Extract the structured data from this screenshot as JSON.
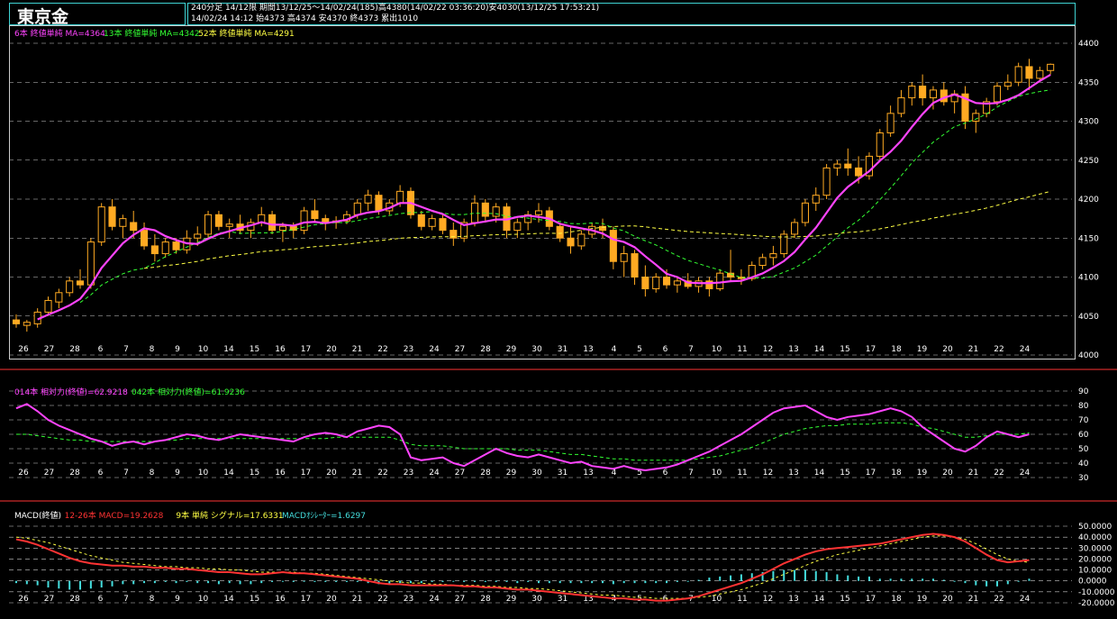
{
  "header": {
    "instrument": "東京金",
    "info_line1": "240分足 14/12限 期間13/12/25～14/02/24(185)高4380(14/02/22 03:36:20)安4030(13/12/25 17:53:21)",
    "info_line2": "14/02/24 14:12 始4373 高4374 安4370 終4373 累出1010"
  },
  "legends": {
    "main": [
      {
        "text": "6本 終値単純 MA=4364",
        "color": "#ff44ff"
      },
      {
        "text": "13本 終値単純 MA=4342",
        "color": "#33ff33"
      },
      {
        "text": "52本 終値単純 MA=4291",
        "color": "#ffff44"
      }
    ],
    "rsi": [
      {
        "text": "014本 相対力(終値)=62.9218",
        "color": "#ff44ff"
      },
      {
        "text": "042本 相対力(終値)=61.9236",
        "color": "#33ff33"
      }
    ],
    "macd": [
      {
        "text": "MACD(終値)",
        "color": "#ffffff"
      },
      {
        "text": "12-26本 MACD=19.2628",
        "color": "#ff3333"
      },
      {
        "text": "9本 単純 シグナル=17.6331",
        "color": "#ffff44"
      },
      {
        "text": "MACDｵｼﾚｰﾀｰ=1.6297",
        "color": "#44dddd"
      }
    ]
  },
  "day_labels": [
    "26",
    "27",
    "28",
    "6",
    "7",
    "8",
    "9",
    "10",
    "14",
    "15",
    "16",
    "17",
    "20",
    "21",
    "22",
    "23",
    "24",
    "27",
    "28",
    "29",
    "30",
    "31",
    "13",
    "4",
    "5",
    "6",
    "7",
    "10",
    "11",
    "12",
    "13",
    "14",
    "15",
    "17",
    "18",
    "19",
    "20",
    "21",
    "22",
    "24"
  ],
  "colors": {
    "up": "#ffaa22",
    "down": "#ffaa22",
    "ma6": "#ff44ff",
    "ma13": "#33ff33",
    "ma52": "#ffff44",
    "macd": "#ff3333",
    "signal": "#ffff44",
    "osc": "#44dddd",
    "frame": "#3fd3d3"
  },
  "chart_data": [
    {
      "type": "candlestick",
      "name": "price",
      "ylim": [
        4000,
        4400
      ],
      "yticks": [
        "4400",
        "4350",
        "4300",
        "4250",
        "4200",
        "4150",
        "4100",
        "4050",
        "4000"
      ],
      "ohlc": [
        [
          4045,
          4052,
          4035,
          4040
        ],
        [
          4038,
          4045,
          4030,
          4042
        ],
        [
          4040,
          4060,
          4035,
          4055
        ],
        [
          4055,
          4075,
          4050,
          4070
        ],
        [
          4068,
          4085,
          4060,
          4080
        ],
        [
          4080,
          4100,
          4075,
          4095
        ],
        [
          4095,
          4110,
          4085,
          4090
        ],
        [
          4090,
          4150,
          4085,
          4145
        ],
        [
          4145,
          4195,
          4140,
          4190
        ],
        [
          4190,
          4200,
          4160,
          4165
        ],
        [
          4165,
          4180,
          4150,
          4175
        ],
        [
          4170,
          4185,
          4150,
          4160
        ],
        [
          4160,
          4170,
          4135,
          4140
        ],
        [
          4140,
          4155,
          4120,
          4130
        ],
        [
          4130,
          4150,
          4125,
          4145
        ],
        [
          4145,
          4150,
          4130,
          4135
        ],
        [
          4135,
          4160,
          4130,
          4150
        ],
        [
          4150,
          4165,
          4140,
          4155
        ],
        [
          4155,
          4185,
          4150,
          4180
        ],
        [
          4180,
          4185,
          4160,
          4165
        ],
        [
          4165,
          4175,
          4150,
          4168
        ],
        [
          4168,
          4180,
          4155,
          4160
        ],
        [
          4160,
          4175,
          4150,
          4170
        ],
        [
          4170,
          4190,
          4165,
          4180
        ],
        [
          4180,
          4185,
          4155,
          4160
        ],
        [
          4160,
          4170,
          4145,
          4165
        ],
        [
          4165,
          4170,
          4150,
          4160
        ],
        [
          4160,
          4190,
          4155,
          4185
        ],
        [
          4185,
          4200,
          4170,
          4175
        ],
        [
          4175,
          4180,
          4160,
          4170
        ],
        [
          4170,
          4178,
          4162,
          4172
        ],
        [
          4172,
          4185,
          4168,
          4180
        ],
        [
          4180,
          4200,
          4175,
          4195
        ],
        [
          4195,
          4212,
          4185,
          4205
        ],
        [
          4205,
          4210,
          4180,
          4185
        ],
        [
          4185,
          4200,
          4180,
          4195
        ],
        [
          4195,
          4218,
          4190,
          4210
        ],
        [
          4210,
          4215,
          4175,
          4180
        ],
        [
          4180,
          4185,
          4160,
          4165
        ],
        [
          4165,
          4180,
          4160,
          4175
        ],
        [
          4175,
          4180,
          4155,
          4160
        ],
        [
          4160,
          4170,
          4140,
          4150
        ],
        [
          4150,
          4175,
          4145,
          4170
        ],
        [
          4170,
          4205,
          4165,
          4195
        ],
        [
          4195,
          4200,
          4170,
          4178
        ],
        [
          4178,
          4195,
          4170,
          4190
        ],
        [
          4190,
          4195,
          4150,
          4160
        ],
        [
          4160,
          4175,
          4150,
          4170
        ],
        [
          4170,
          4185,
          4160,
          4180
        ],
        [
          4180,
          4195,
          4170,
          4185
        ],
        [
          4185,
          4190,
          4160,
          4165
        ],
        [
          4165,
          4170,
          4145,
          4150
        ],
        [
          4150,
          4165,
          4130,
          4140
        ],
        [
          4140,
          4160,
          4135,
          4155
        ],
        [
          4155,
          4170,
          4150,
          4165
        ],
        [
          4165,
          4175,
          4150,
          4160
        ],
        [
          4160,
          4165,
          4110,
          4120
        ],
        [
          4120,
          4140,
          4100,
          4130
        ],
        [
          4130,
          4135,
          4090,
          4100
        ],
        [
          4100,
          4115,
          4075,
          4085
        ],
        [
          4085,
          4105,
          4080,
          4100
        ],
        [
          4100,
          4110,
          4085,
          4090
        ],
        [
          4090,
          4100,
          4080,
          4095
        ],
        [
          4095,
          4105,
          4085,
          4088
        ],
        [
          4088,
          4100,
          4080,
          4095
        ],
        [
          4095,
          4100,
          4075,
          4085
        ],
        [
          4085,
          4110,
          4082,
          4105
        ],
        [
          4105,
          4135,
          4095,
          4100
        ],
        [
          4100,
          4110,
          4090,
          4098
        ],
        [
          4098,
          4120,
          4095,
          4115
        ],
        [
          4115,
          4130,
          4110,
          4125
        ],
        [
          4125,
          4140,
          4115,
          4130
        ],
        [
          4130,
          4160,
          4125,
          4155
        ],
        [
          4155,
          4175,
          4150,
          4170
        ],
        [
          4170,
          4200,
          4165,
          4195
        ],
        [
          4195,
          4215,
          4185,
          4205
        ],
        [
          4205,
          4245,
          4200,
          4240
        ],
        [
          4240,
          4250,
          4230,
          4245
        ],
        [
          4245,
          4265,
          4230,
          4240
        ],
        [
          4240,
          4255,
          4220,
          4230
        ],
        [
          4230,
          4260,
          4225,
          4255
        ],
        [
          4255,
          4290,
          4250,
          4285
        ],
        [
          4285,
          4320,
          4280,
          4310
        ],
        [
          4310,
          4340,
          4305,
          4330
        ],
        [
          4330,
          4350,
          4320,
          4345
        ],
        [
          4345,
          4360,
          4320,
          4330
        ],
        [
          4330,
          4345,
          4315,
          4340
        ],
        [
          4340,
          4350,
          4320,
          4325
        ],
        [
          4325,
          4340,
          4310,
          4335
        ],
        [
          4335,
          4345,
          4290,
          4300
        ],
        [
          4300,
          4315,
          4285,
          4310
        ],
        [
          4310,
          4330,
          4305,
          4325
        ],
        [
          4325,
          4350,
          4320,
          4345
        ],
        [
          4345,
          4360,
          4340,
          4350
        ],
        [
          4350,
          4375,
          4345,
          4370
        ],
        [
          4370,
          4380,
          4340,
          4355
        ],
        [
          4355,
          4370,
          4350,
          4365
        ],
        [
          4365,
          4374,
          4360,
          4373
        ]
      ]
    },
    {
      "type": "line",
      "name": "rsi",
      "ylim": [
        30,
        90
      ],
      "yticks": [
        "90",
        "80",
        "70",
        "60",
        "50",
        "40",
        "30"
      ],
      "series": [
        {
          "name": "014本 相対力(終値)",
          "values": [
            78,
            81,
            76,
            70,
            66,
            63,
            60,
            57,
            55,
            52,
            54,
            55,
            53,
            55,
            56,
            58,
            60,
            59,
            57,
            56,
            58,
            60,
            59,
            58,
            57,
            56,
            55,
            58,
            60,
            61,
            60,
            58,
            62,
            64,
            66,
            65,
            60,
            44,
            42,
            43,
            44,
            40,
            38,
            42,
            46,
            50,
            47,
            45,
            44,
            46,
            44,
            42,
            40,
            41,
            38,
            37,
            36,
            38,
            36,
            35,
            36,
            37,
            39,
            42,
            45,
            48,
            52,
            56,
            60,
            65,
            70,
            75,
            78,
            79,
            80,
            76,
            72,
            70,
            72,
            73,
            74,
            76,
            78,
            76,
            72,
            65,
            60,
            55,
            50,
            48,
            52,
            58,
            62,
            60,
            58,
            60
          ]
        },
        {
          "name": "042本 相対力(終値)",
          "values": [
            60,
            60,
            59,
            58,
            57,
            56,
            56,
            55,
            55,
            55,
            55,
            55,
            55,
            55,
            56,
            56,
            57,
            57,
            57,
            57,
            57,
            57,
            57,
            57,
            57,
            57,
            57,
            57,
            57,
            57,
            58,
            58,
            58,
            58,
            58,
            58,
            56,
            53,
            52,
            52,
            52,
            51,
            50,
            50,
            50,
            50,
            50,
            49,
            49,
            49,
            48,
            47,
            46,
            46,
            45,
            44,
            43,
            43,
            42,
            42,
            42,
            42,
            42,
            42,
            43,
            44,
            45,
            47,
            49,
            51,
            54,
            57,
            60,
            62,
            64,
            65,
            66,
            66,
            67,
            67,
            67,
            68,
            68,
            68,
            67,
            65,
            64,
            62,
            60,
            58,
            58,
            59,
            60,
            60,
            60,
            61
          ]
        }
      ]
    },
    {
      "type": "line",
      "name": "macd",
      "ylim": [
        -20,
        50
      ],
      "yticks": [
        "50.0000",
        "40.0000",
        "30.0000",
        "20.0000",
        "10.0000",
        "0.0000",
        "-10.0000",
        "-20.0000"
      ],
      "series": [
        {
          "name": "12-26本 MACD",
          "values": [
            38,
            36,
            33,
            29,
            25,
            21,
            18,
            16,
            15,
            14,
            14,
            13,
            13,
            12,
            12,
            11,
            11,
            10,
            9,
            8,
            8,
            7,
            6,
            6,
            7,
            8,
            7,
            7,
            6,
            5,
            4,
            3,
            2,
            0,
            -2,
            -3,
            -3,
            -4,
            -4,
            -4,
            -4,
            -4,
            -5,
            -5,
            -6,
            -6,
            -7,
            -8,
            -8,
            -9,
            -10,
            -11,
            -12,
            -13,
            -14,
            -15,
            -16,
            -16,
            -17,
            -17,
            -18,
            -18,
            -17,
            -16,
            -14,
            -11,
            -8,
            -5,
            -2,
            2,
            6,
            11,
            16,
            20,
            24,
            27,
            29,
            30,
            31,
            32,
            33,
            34,
            36,
            38,
            40,
            42,
            43,
            42,
            40,
            36,
            30,
            24,
            19,
            17,
            18,
            19
          ]
        },
        {
          "name": "9本 単純 シグナル",
          "values": [
            40,
            39,
            37,
            35,
            32,
            29,
            26,
            23,
            21,
            19,
            17,
            16,
            15,
            14,
            13,
            13,
            12,
            12,
            11,
            11,
            10,
            10,
            9,
            8,
            8,
            8,
            8,
            7,
            7,
            6,
            5,
            4,
            3,
            2,
            1,
            0,
            -1,
            -2,
            -2,
            -3,
            -3,
            -4,
            -4,
            -4,
            -5,
            -5,
            -6,
            -6,
            -7,
            -7,
            -8,
            -9,
            -10,
            -11,
            -12,
            -13,
            -13,
            -14,
            -15,
            -15,
            -16,
            -16,
            -16,
            -16,
            -15,
            -14,
            -12,
            -10,
            -8,
            -5,
            -2,
            2,
            6,
            10,
            14,
            18,
            21,
            24,
            26,
            28,
            30,
            32,
            34,
            36,
            38,
            40,
            41,
            41,
            40,
            38,
            34,
            29,
            24,
            20,
            18,
            17
          ]
        },
        {
          "name": "MACDｵｼﾚｰﾀｰ",
          "values": [
            -2,
            -3,
            -4,
            -6,
            -7,
            -8,
            -8,
            -7,
            -6,
            -5,
            -3,
            -3,
            -2,
            -2,
            -1,
            -2,
            -1,
            -2,
            -2,
            -3,
            -2,
            -3,
            -3,
            -2,
            -1,
            0,
            -1,
            0,
            -1,
            -1,
            -1,
            -1,
            -1,
            -2,
            -3,
            -3,
            -2,
            -2,
            -2,
            -1,
            -1,
            0,
            -1,
            -1,
            -1,
            -1,
            -1,
            -2,
            -1,
            -2,
            -2,
            -2,
            -2,
            -2,
            -2,
            -2,
            -3,
            -2,
            -2,
            -2,
            -2,
            -2,
            -1,
            0,
            1,
            3,
            4,
            5,
            6,
            7,
            8,
            9,
            10,
            10,
            10,
            9,
            8,
            6,
            5,
            4,
            4,
            2,
            2,
            2,
            2,
            2,
            2,
            1,
            0,
            -2,
            -4,
            -5,
            -5,
            -3,
            0,
            2
          ]
        }
      ]
    }
  ]
}
